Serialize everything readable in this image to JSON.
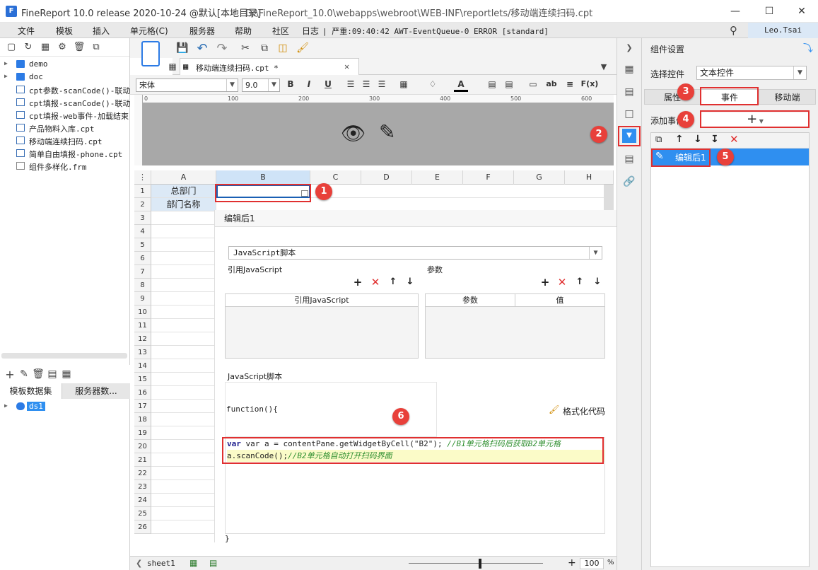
{
  "titlebar": {
    "app_title": "FineReport 10.0 release 2020-10-24 @默认[本地目录]",
    "path": "D:\\FineReport_10.0\\webapps\\webroot\\WEB-INF\\reportlets/移动端连续扫码.cpt",
    "minimize": "—",
    "maximize": "☐",
    "close": "✕"
  },
  "menubar": {
    "items": [
      "文件",
      "模板",
      "插入",
      "单元格(C)",
      "服务器",
      "帮助",
      "社区",
      "日志"
    ],
    "log_text": "| 严重:09:40:42 AWT-EventQueue-0 ERROR [standard]",
    "user": "Leo.Tsai"
  },
  "file_tree": {
    "items": [
      {
        "label": "demo",
        "type": "folder"
      },
      {
        "label": "doc",
        "type": "folder"
      },
      {
        "label": "cpt参数-scanCode()-联动",
        "type": "doc"
      },
      {
        "label": "cpt填报-scanCode()-联动",
        "type": "doc"
      },
      {
        "label": "cpt填报-web事件-加载结束",
        "type": "doc"
      },
      {
        "label": "产品物料入库.cpt",
        "type": "doc"
      },
      {
        "label": "移动端连续扫码.cpt",
        "type": "doc"
      },
      {
        "label": "简单自由填报-phone.cpt",
        "type": "doc"
      },
      {
        "label": "组件多样化.frm",
        "type": "frm"
      }
    ]
  },
  "dataset_panel": {
    "tabs": [
      "模板数据集",
      "服务器数..."
    ],
    "items": [
      "ds1"
    ]
  },
  "editor_tab": {
    "label": "移动端连续扫码.cpt *"
  },
  "format_toolbar": {
    "font": "宋体",
    "size": "9.0",
    "bold": "B",
    "italic": "I",
    "underline": "U",
    "ab": "ab",
    "fx": "F(x)"
  },
  "ruler": {
    "marks": [
      "0",
      "100",
      "200",
      "300",
      "400",
      "500",
      "600"
    ]
  },
  "grid": {
    "columns": [
      "A",
      "B",
      "C",
      "D",
      "E",
      "F",
      "G",
      "H"
    ],
    "rows": [
      "1",
      "2",
      "3",
      "4",
      "5",
      "6",
      "7",
      "8",
      "9",
      "10",
      "11",
      "12",
      "13",
      "14",
      "15",
      "16",
      "17",
      "18",
      "19",
      "20",
      "21",
      "22",
      "23",
      "24",
      "25",
      "26"
    ],
    "cells": {
      "A1": "总部门",
      "A2": "部门名称"
    }
  },
  "statusbar": {
    "sheet": "sheet1",
    "zoom": "100",
    "percent": "%"
  },
  "event_dialog": {
    "title": "编辑后1",
    "type_select": "JavaScript脚本",
    "ref_js_label": "引用JavaScript",
    "params_label": "参数",
    "ref_js_column": "引用JavaScript",
    "param_columns": [
      "参数",
      "值"
    ],
    "script_label": "JavaScript脚本",
    "function_open": "function(){",
    "format_code": "格式化代码",
    "code_lines": [
      {
        "code": "var a = contentPane.getWidgetByCell(\"B2\"); ",
        "comment": "//B1单元格扫码后获取B2单元格"
      },
      {
        "code": "a.scanCode();",
        "comment": "//B2单元格自动打开扫码界面"
      }
    ],
    "function_close": "}"
  },
  "right_panel": {
    "title": "组件设置",
    "select_widget_label": "选择控件",
    "select_widget_value": "文本控件",
    "tabs": [
      "属性",
      "事件",
      "移动端"
    ],
    "add_event_label": "添加事件",
    "add_button": "+",
    "events": [
      {
        "label": "编辑后1"
      }
    ]
  },
  "badges": [
    "1",
    "2",
    "3",
    "4",
    "5",
    "6"
  ],
  "colors": {
    "accent": "#2f8ff0",
    "highlight": "#e03030",
    "selected_cell_header": "#cfe3f7"
  }
}
